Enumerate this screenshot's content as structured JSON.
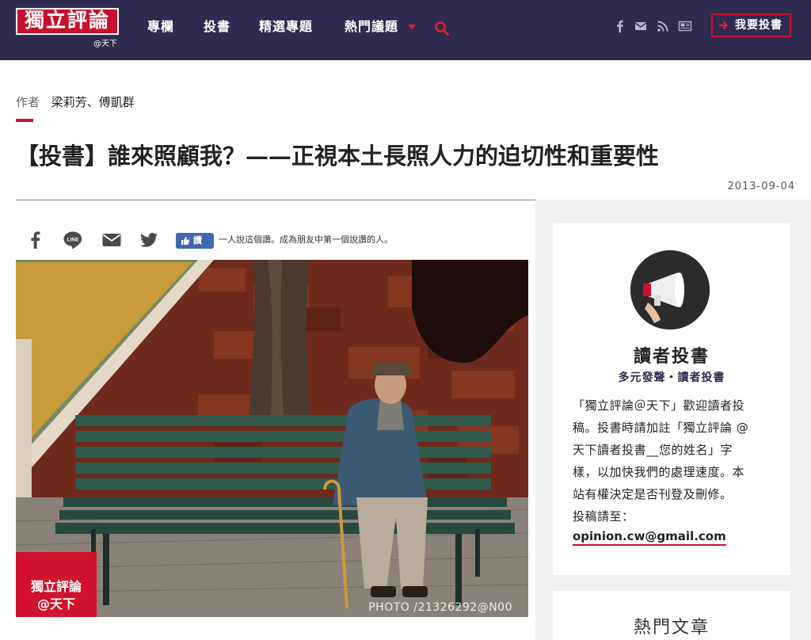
{
  "header": {
    "logo_text": "獨立評論",
    "logo_sub": "@天下",
    "nav": [
      "專欄",
      "投書",
      "精選專題",
      "熱門議題"
    ],
    "submit_label": "我要投書"
  },
  "article": {
    "author_label": "作者",
    "author_name": "梁莉芳、傅凱群",
    "title": "【投書】誰來照顧我？——正視本土長照人力的迫切性和重要性",
    "date": "2013-09-04"
  },
  "share": {
    "like_label": "讚",
    "like_text": "一人說這個讚。成為朋友中第一個說讚的人。"
  },
  "hero": {
    "badge_line1": "獨立評論",
    "badge_line2": "@天下",
    "photo_credit": "PHOTO /21326292@N00"
  },
  "sidebar": {
    "card_title": "讀者投書",
    "card_subtitle": "多元發聲・讀者投書",
    "card_lines": [
      "「獨立評論＠天下」歡迎讀者投",
      "稿。投書時請加註「獨立評論 @",
      "天下讀者投書__您的姓名」字",
      "樣，以加快我們的處理速度。本",
      "站有權決定是否刊登及刪修。",
      "投稿請至："
    ],
    "email": "opinion.cw@gmail.com",
    "popular_title": "熱門文章"
  },
  "colors": {
    "nav_bg": "#2f2a4f",
    "brand_red": "#c8102e",
    "sidebar_bg": "#f1f1f1"
  }
}
